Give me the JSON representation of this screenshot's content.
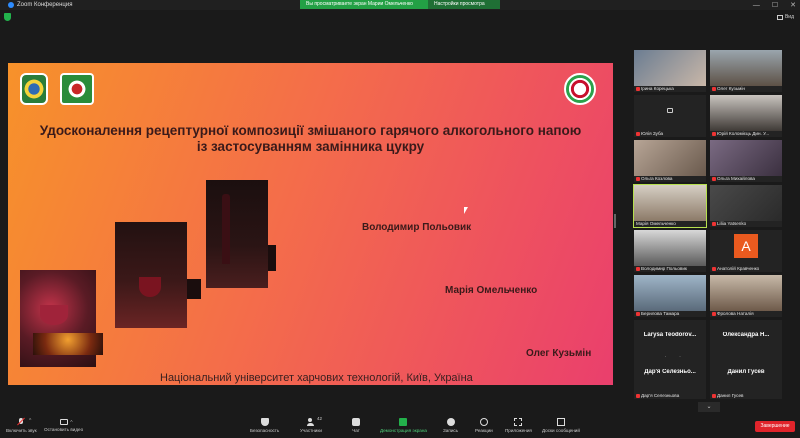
{
  "window": {
    "title": "Zoom Конференция",
    "share_banner": "Вы просматриваете экран Марии Омельченко",
    "share_options": "Настройки просмотра",
    "view_label": "Вид"
  },
  "slide": {
    "title_line1": "Удосконалення рецептурної композиції змішаного гарячого алкогольного напою",
    "title_line2": "із застосуванням замінника цукру",
    "authors": [
      "Володимир Польовик",
      "Марія Омельченко",
      "Олег Кузьмін"
    ],
    "footer": "Національний університет харчових технологій, Київ, Україна"
  },
  "participants": [
    {
      "name": "Ірина Корецька"
    },
    {
      "name": "Олег Кузьмін"
    },
    {
      "name": "Юлія Зуба"
    },
    {
      "name": "Юрій Коломієць Дин. У..."
    },
    {
      "name": "Ольга Козлова"
    },
    {
      "name": "Ольга Михайлова"
    },
    {
      "name": "Марія Омельченко"
    },
    {
      "name": "Liliia Yatsenko"
    },
    {
      "name": "Володимир Польовик"
    },
    {
      "name": "Анатолій Кравченко"
    },
    {
      "name": "Берилова Тамара"
    },
    {
      "name": "Фролова Наталія"
    },
    {
      "name": "Larysa Teodorovych",
      "big": "Larysa Teodorov..."
    },
    {
      "name": "Олександра Нагорна",
      "big": "Олександра Н..."
    },
    {
      "name": "Дар'я Селезньова",
      "big": "Дар'я Селезньо..."
    },
    {
      "name": "Данил Гусев",
      "big": "Данил Гусев"
    }
  ],
  "avatar_letter": "A",
  "toolbar": {
    "mute": "Включить звук",
    "video": "Остановить видео",
    "security": "Безопасность",
    "participants": "Участники",
    "participants_count": "42",
    "chat": "Чат",
    "share": "Демонстрация экрана",
    "record": "Запись",
    "reactions": "Реакции",
    "apps": "Приложения",
    "notes": "Доски сообщений",
    "end": "Завершение"
  },
  "colors": {
    "accent_green": "#23a045",
    "end_red": "#e0242b",
    "active_speaker": "#b6e04e"
  }
}
